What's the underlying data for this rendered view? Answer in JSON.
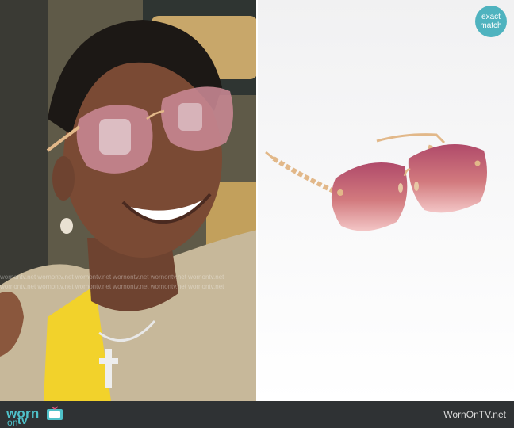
{
  "badge": {
    "line1": "exact",
    "line2": "match"
  },
  "footer": {
    "logo_worn": "worn",
    "logo_on": "on",
    "logo_tv": "tv",
    "site": "WornOnTV.net"
  },
  "watermark": {
    "row1": "wornontv.net  wornontv.net  wornontv.net  wornontv.net  wornontv.net  wornontv.net",
    "row2": "wornontv.net  wornontv.net  wornontv.net  wornontv.net  wornontv.net  wornontv.net"
  },
  "colors": {
    "accent": "#4fc1c9",
    "footer_bg": "#2f3234",
    "lens_top": "#b04a6a",
    "lens_bottom": "#f3c6c6",
    "frame_gold": "#e2b889"
  },
  "icons": {
    "tv": "tv-icon"
  }
}
